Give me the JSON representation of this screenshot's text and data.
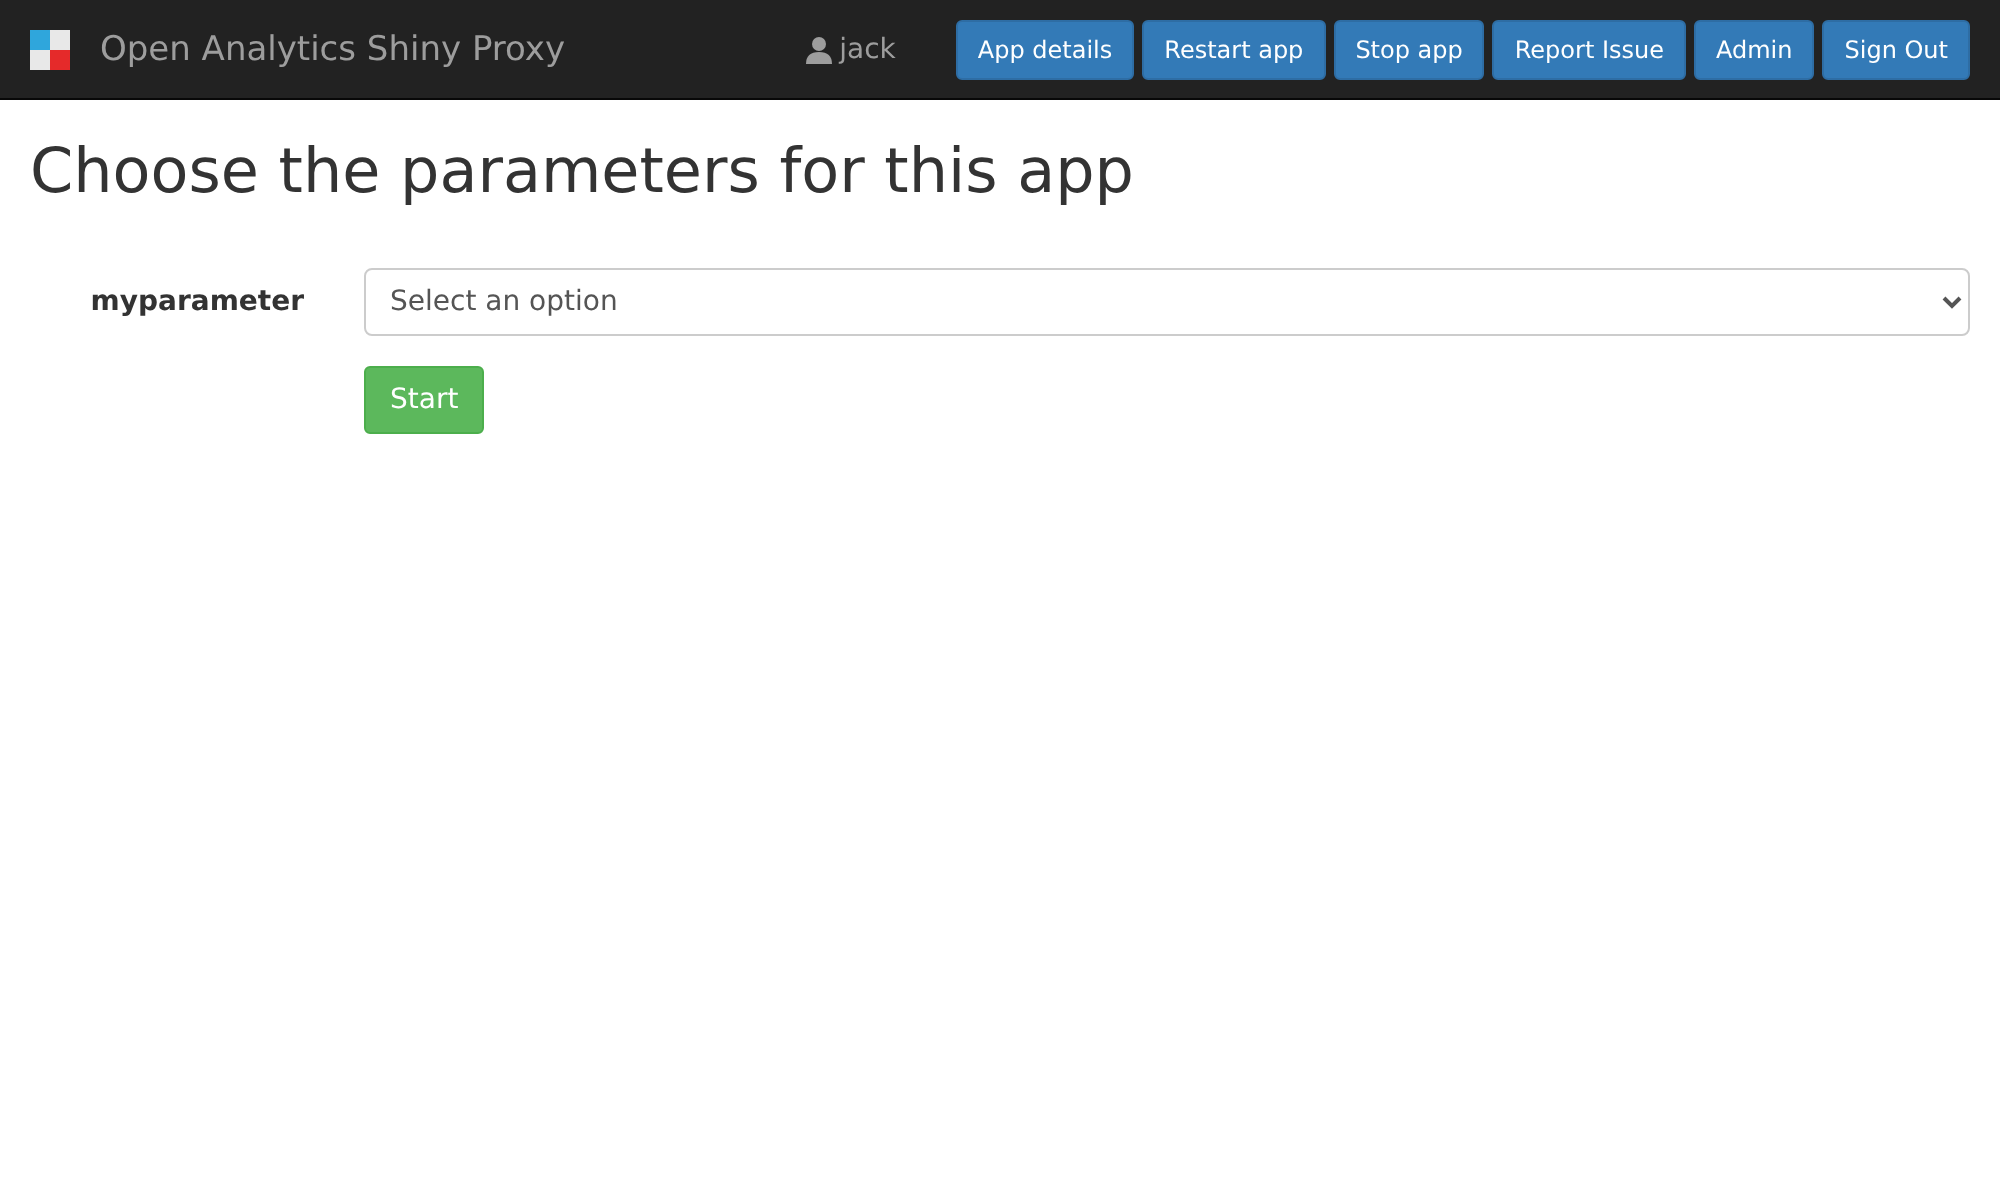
{
  "navbar": {
    "brand": "Open Analytics Shiny Proxy",
    "user": "jack",
    "buttons": [
      "App details",
      "Restart app",
      "Stop app",
      "Report Issue",
      "Admin",
      "Sign Out"
    ]
  },
  "heading": "Choose the parameters for this app",
  "form": {
    "parameters": [
      {
        "label": "myparameter",
        "placeholder": "Select an option"
      }
    ],
    "submit": "Start"
  }
}
